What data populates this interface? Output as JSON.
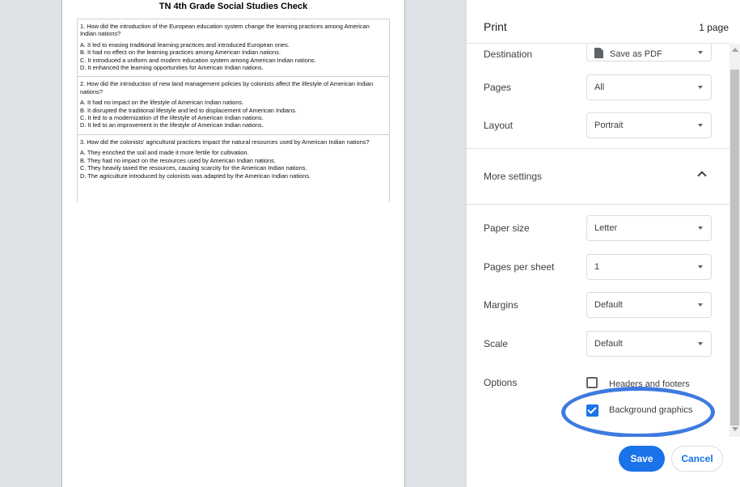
{
  "document": {
    "title": "TN 4th Grade Social Studies Check",
    "questions": [
      {
        "text": "1. How did the introduction of the European education system change the learning practices among American Indian nations?",
        "options": [
          "A. It led to erasing traditional learning practices and introduced European ones.",
          "B. It had no effect on the learning practices among American Indian nations.",
          "C. It introduced a uniform and modern education system among American Indian nations.",
          "D. It enhanced the learning opportunities for American Indian nations."
        ]
      },
      {
        "text": "2. How did the introduction of new land management policies by colonists affect the lifestyle of American Indian nations?",
        "options": [
          "A. It had no impact on the lifestyle of American Indian nations.",
          "B. It disrupted the traditional lifestyle and led to displacement of American Indians.",
          "C. It led to a modernization of the lifestyle of American Indian nations.",
          "D. It led to an improvement in the lifestyle of American Indian nations."
        ]
      },
      {
        "text": "3. How did the colonists' agricultural practices impact the natural resources used by American Indian nations?",
        "options": [
          "A. They enriched the soil and made it more fertile for cultivation.",
          "B. They had no impact on the resources used by American Indian nations.",
          "C. They heavily taxed the resources, causing scarcity for the American Indian nations.",
          "D. The agriculture introduced by colonists was adapted by the American Indian nations."
        ]
      }
    ]
  },
  "panel": {
    "title": "Print",
    "page_count": "1 page",
    "destination": {
      "label": "Destination",
      "value": "Save as PDF",
      "icon": "file-icon"
    },
    "pages": {
      "label": "Pages",
      "value": "All"
    },
    "layout": {
      "label": "Layout",
      "value": "Portrait"
    },
    "more_settings": {
      "label": "More settings",
      "expanded": true
    },
    "paper_size": {
      "label": "Paper size",
      "value": "Letter"
    },
    "pages_per_sheet": {
      "label": "Pages per sheet",
      "value": "1"
    },
    "margins": {
      "label": "Margins",
      "value": "Default"
    },
    "scale": {
      "label": "Scale",
      "value": "Default"
    },
    "options": {
      "label": "Options",
      "headers_footers": {
        "label": "Headers and footers",
        "checked": false
      },
      "background_graphics": {
        "label": "Background graphics",
        "checked": true
      }
    },
    "buttons": {
      "save": "Save",
      "cancel": "Cancel"
    }
  },
  "colors": {
    "accent": "#1a73e8",
    "highlight": "#3d7ae0",
    "preview_bg": "#dee1e6"
  }
}
